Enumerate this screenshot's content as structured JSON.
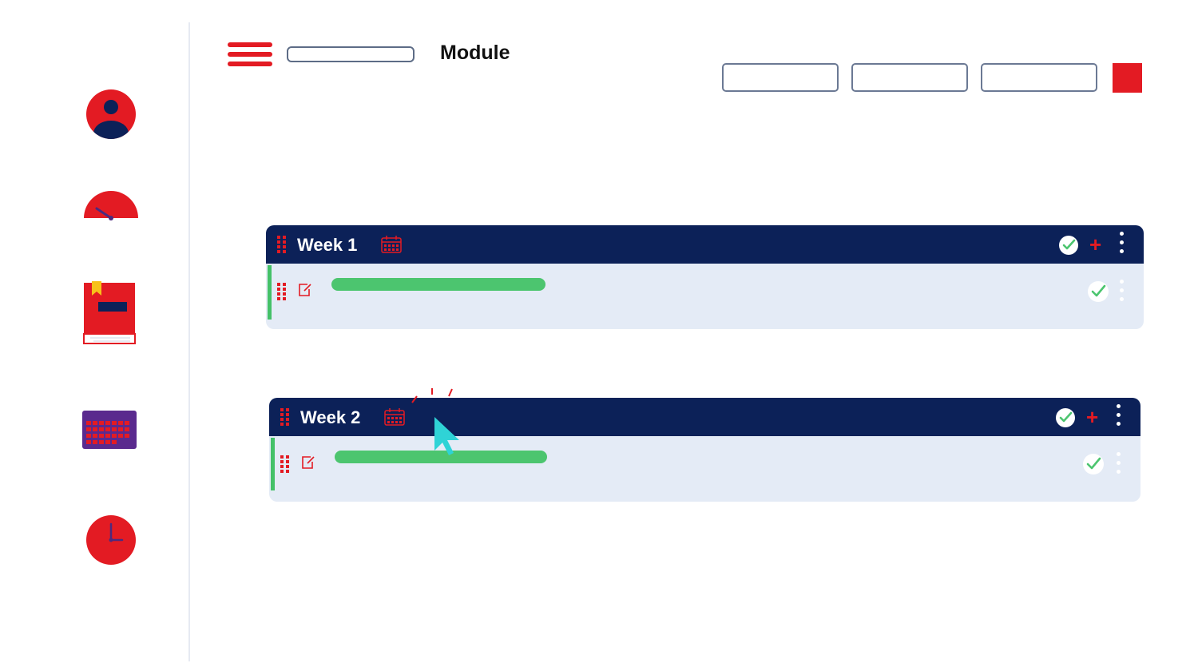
{
  "header": {
    "title": "Module",
    "search": {
      "value": "",
      "placeholder": ""
    },
    "buttons": [
      "",
      "",
      ""
    ],
    "menu_icon": "hamburger-icon",
    "accent_color": "#e31b23"
  },
  "sidebar": {
    "items": [
      {
        "icon": "user-profile-icon"
      },
      {
        "icon": "dashboard-gauge-icon"
      },
      {
        "icon": "book-icon"
      },
      {
        "icon": "calendar-icon"
      },
      {
        "icon": "clock-icon"
      }
    ]
  },
  "weeks": [
    {
      "title": "Week 1",
      "icons": [
        "drag-handle-icon",
        "calendar-icon",
        "check-circle-icon",
        "plus-icon",
        "more-vertical-icon"
      ],
      "rows": [
        {
          "icon": "edit-icon",
          "progress": 1.0,
          "completed": true
        }
      ]
    },
    {
      "title": "Week 2",
      "icons": [
        "drag-handle-icon",
        "calendar-icon",
        "check-circle-icon",
        "plus-icon",
        "more-vertical-icon"
      ],
      "rows": [
        {
          "icon": "edit-icon",
          "progress": 1.0,
          "completed": true
        }
      ]
    }
  ],
  "colors": {
    "navy": "#0c2158",
    "red": "#e31b23",
    "green": "#4cc56f",
    "card_bg": "#e4ebf6",
    "cursor": "#2fd3d6"
  },
  "cursor_icon": "mouse-pointer-icon"
}
